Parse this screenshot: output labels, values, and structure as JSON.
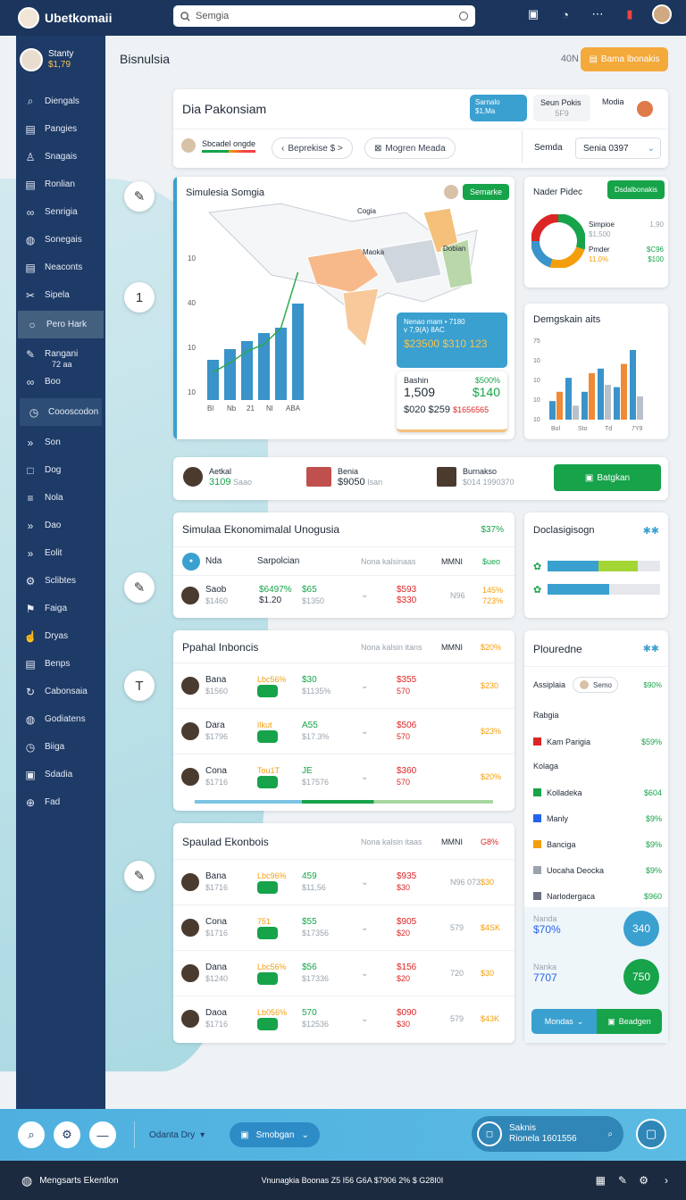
{
  "app": {
    "title": "Ubetkomaii",
    "search_placeholder": "Semgia"
  },
  "user": {
    "name": "Stanty",
    "amount": "$1,79"
  },
  "sidebar": {
    "items": [
      {
        "icon": "search-icon",
        "label": "Diengals"
      },
      {
        "icon": "document-icon",
        "label": "Pangies"
      },
      {
        "icon": "user-icon",
        "label": "Snagais"
      },
      {
        "icon": "document-icon",
        "label": "Ronlian"
      },
      {
        "icon": "link-icon",
        "label": "Senrigia"
      },
      {
        "icon": "globe-icon",
        "label": "Sonegais"
      },
      {
        "icon": "document-icon",
        "label": "Neaconts"
      },
      {
        "icon": "tool-icon",
        "label": "Sipela"
      },
      {
        "icon": "circle-icon",
        "label": "Pero Hark"
      },
      {
        "icon": "pen-icon",
        "label": "Rangani",
        "sub": "72 aa"
      },
      {
        "icon": "link-icon",
        "label": "Boo"
      },
      {
        "icon": "clock-icon",
        "label": "Coooscodon"
      },
      {
        "icon": "arrow-icon",
        "label": "Son"
      },
      {
        "icon": "square-icon",
        "label": "Dog"
      },
      {
        "icon": "list-icon",
        "label": "Nola"
      },
      {
        "icon": "arrow-icon",
        "label": "Dao"
      },
      {
        "icon": "arrow-icon",
        "label": "Eolit"
      },
      {
        "icon": "gear-icon",
        "label": "Sclibtes"
      },
      {
        "icon": "flag-icon",
        "label": "Faiga"
      },
      {
        "icon": "hand-icon",
        "label": "Dryas"
      },
      {
        "icon": "document-icon",
        "label": "Benps"
      },
      {
        "icon": "refresh-icon",
        "label": "Cabonsaia"
      },
      {
        "icon": "globe-icon",
        "label": "Godiatens"
      },
      {
        "icon": "clock-icon",
        "label": "Biiga"
      },
      {
        "icon": "image-icon",
        "label": "Sdadia"
      },
      {
        "icon": "plus-icon",
        "label": "Fad"
      }
    ]
  },
  "header": {
    "title": "Bisnulsia",
    "chip": "40N",
    "button": "Bama lbonakis"
  },
  "panel_top": {
    "title": "Dia Pakonsiam",
    "user1": {
      "name": "Sarnalo",
      "amount": "$1,Ma"
    },
    "user2": {
      "name": "Seun Pokis",
      "amount": "5F9"
    },
    "user3": {
      "name": "Modia"
    },
    "filter1": "Sbcadel ongde",
    "filter2": "Beprekise $ >",
    "filter3": "Mogren Meada",
    "select_label": "Semda",
    "select_value": "Senia  0397"
  },
  "map_card": {
    "title": "Simulesia Somgia",
    "badge": "Semarke",
    "labels": [
      "Cogia",
      "Maoka",
      "Dobian"
    ],
    "y_ticks": [
      "10",
      "40",
      "10",
      "10"
    ],
    "x_ticks": [
      "Bl",
      "Nb",
      "21",
      "Nl",
      "ABA"
    ],
    "popup1": {
      "line1": "Nenao mam • 7180",
      "line2": "v 7,9(A) 8AC",
      "values": "$23500  $310  123"
    },
    "popup2": {
      "label": "Bashin",
      "pct": "$500%",
      "big": "1,509",
      "right": "$140",
      "bottom": "$020  $259",
      "red": "$1656565"
    }
  },
  "chart_data": [
    {
      "type": "bar",
      "categories": [
        "Bl",
        "Nb",
        "21",
        "Nl",
        "ABA"
      ],
      "values": [
        15,
        19,
        22,
        25,
        27,
        36
      ],
      "line": [
        12,
        16,
        21,
        24,
        31,
        55
      ],
      "title": "Simulesia Somgia"
    },
    {
      "type": "pie",
      "values": [
        30,
        25,
        20,
        25
      ],
      "title": "Nader Pidec"
    },
    {
      "type": "bar",
      "title": "Demgskain aits",
      "categories": [
        "Bol",
        "Sto",
        "Td",
        "7Y9"
      ],
      "series": [
        {
          "values": [
            8,
            18,
            12,
            22,
            14,
            30
          ]
        },
        {
          "values": [
            12,
            6,
            20,
            15,
            24,
            10
          ]
        }
      ],
      "y_ticks": [
        "75",
        "10",
        "10",
        "10",
        "10"
      ]
    }
  ],
  "right_top": {
    "title": "Nader Pidec",
    "button": "Dsdalbonakis",
    "legend1": {
      "name": "Simpioe",
      "val": "1,90",
      "sub": "$1,500"
    },
    "legend2": {
      "name": "Pmder",
      "val": "$C96",
      "sub": "11,0%",
      "val2": "$100"
    }
  },
  "right_chart": {
    "title": "Demgskain aits"
  },
  "people_row": {
    "p1": {
      "name": "Aetkal",
      "amount": "3109",
      "sub": "Saao"
    },
    "p2": {
      "name": "Benia",
      "amount": "$9050",
      "sub": "Isan"
    },
    "p3": {
      "name": "Burnakso",
      "amount": "$014 1990370"
    },
    "button": "Batgkan"
  },
  "table1": {
    "title": "Simulaa Ekonomimalal Unogusia",
    "title_val": "$37%",
    "headers": [
      "Nda",
      "Sarpolcian",
      "Nona kalsinaas",
      "MMNI",
      "$ueo"
    ],
    "row": {
      "name": "Saob",
      "sub": "$1460",
      "v1": "$6497%",
      "v2": "$1.20",
      "v3": "$65",
      "v4": "$1350",
      "red": "$593",
      "red2": "$330",
      "muted": "N96",
      "pct": "145%",
      "pct2": "723%"
    }
  },
  "card_decl": {
    "title": "Doclasigisogn",
    "bars": [
      {
        "a": 0.45,
        "b": 0.35
      },
      {
        "a": 0.55,
        "b": 0
      }
    ]
  },
  "table2": {
    "title": "Ppahal Inboncis",
    "headers": [
      "Nona kalsin itans",
      "MMNI",
      "$20%"
    ],
    "rows": [
      {
        "name": "Bana",
        "sub": "$1560",
        "top": "Lbc56%",
        "v": "$30",
        "sub2": "$1135%",
        "red": "$355",
        "red2": "570",
        "pct": "$230"
      },
      {
        "name": "Dara",
        "sub": "$1796",
        "top": "lIkut",
        "v": "A55",
        "sub2": "$17.3%",
        "red": "$506",
        "red2": "570",
        "pct": "$23%"
      },
      {
        "name": "Cona",
        "sub": "$1716",
        "top": "Tou1T",
        "v": "JE",
        "sub2": "$17576",
        "red": "$360",
        "red2": "570",
        "pct": "$20%"
      }
    ]
  },
  "card_plou": {
    "title": "Plouredne",
    "assip": "Assiplaia",
    "semo": "Semo",
    "semo_val": "$90%",
    "sections": [
      {
        "head": "Rabgia",
        "items": [
          {
            "name": "Kam Parigia",
            "val": "$59%",
            "color": "#dc2626"
          }
        ]
      },
      {
        "head": "Kolaga",
        "items": [
          {
            "name": "Kolladeka",
            "val": "$604",
            "color": "#16a34a"
          },
          {
            "name": "Manly",
            "val": "$9%",
            "color": "#2563eb"
          },
          {
            "name": "Banciga",
            "val": "$9%",
            "color": "#f59e0b"
          },
          {
            "name": "Uocaha Deocka",
            "val": "$9%",
            "color": "#9ca3af"
          },
          {
            "name": "Narlodergaca",
            "val": "$960",
            "color": "#6b7280"
          }
        ]
      }
    ],
    "stat1": {
      "label": "Nanda",
      "val": "$70%",
      "circle": "340"
    },
    "stat2": {
      "label": "Nanka",
      "val": "7707",
      "circle": "750"
    },
    "btn1": "Mondas",
    "btn2": "Beadgen"
  },
  "table3": {
    "title": "Spaulad Ekonbois",
    "headers": [
      "Nona kalsin itaas",
      "MMNI",
      "G8%"
    ],
    "rows": [
      {
        "name": "Bana",
        "sub": "$1716",
        "top": "Lbc96%",
        "v": "459",
        "sub2": "$11,56",
        "red": "$935",
        "red2": "$30",
        "muted": "N96 073",
        "pct": "$30"
      },
      {
        "name": "Cona",
        "sub": "$1716",
        "top": "751",
        "v": "$55",
        "sub2": "$17356",
        "red": "$905",
        "red2": "$20",
        "muted": "579",
        "pct": "$4SK"
      },
      {
        "name": "Dana",
        "sub": "$1240",
        "top": "Lbc56%",
        "v": "$56",
        "sub2": "$17336",
        "red": "$156",
        "red2": "$20",
        "muted": "720",
        "pct": "$30"
      },
      {
        "name": "Daoa",
        "sub": "$1716",
        "top": "Lb056%",
        "v": "570",
        "sub2": "$12536",
        "red": "$090",
        "red2": "$30",
        "muted": "579",
        "pct": "$43K"
      }
    ]
  },
  "bottombar": {
    "select1": "Odanta Dry",
    "select2": "Smobgan",
    "right_label": "Saknis",
    "right_sub": "Rionela 1601556"
  },
  "footer": {
    "left": "Mengsarts Ekentlon",
    "middle": "Vnunagkia Boonas  Z5 I56  G6A  $7906  2%  $  G28I0I"
  }
}
